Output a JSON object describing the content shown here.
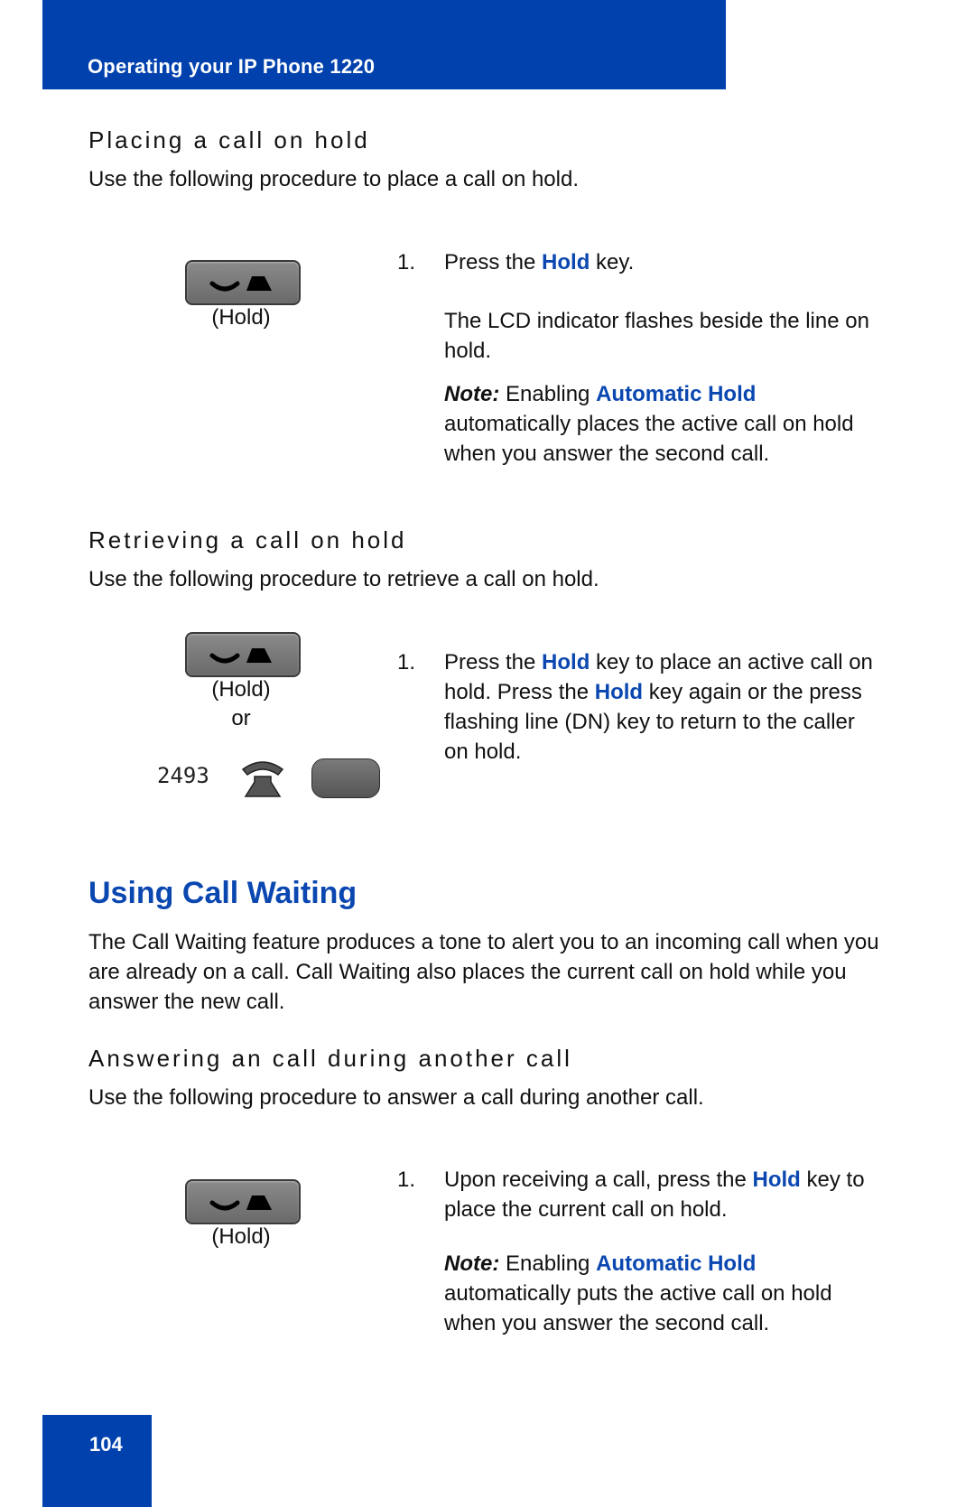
{
  "header": {
    "title": "Operating your IP Phone 1220"
  },
  "colors": {
    "brand_blue": "#0041ad",
    "link_blue": "#0a47b0"
  },
  "section_placing": {
    "heading": "Placing a call on hold",
    "intro": "Use the following procedure to place a call on hold.",
    "key_caption": "(Hold)",
    "step_number": "1.",
    "step_pre": "Press the ",
    "step_key": "Hold",
    "step_post": " key.",
    "detail": "The LCD indicator flashes beside the line on hold.",
    "note_label": "Note:",
    "note_pre": " Enabling ",
    "note_feature": "Automatic Hold",
    "note_post": " automatically places the active call on hold when you answer the second call."
  },
  "section_retrieving": {
    "heading": "Retrieving a call on hold",
    "intro": "Use the following procedure to retrieve a call on hold.",
    "key_caption": "(Hold)",
    "or_label": "or",
    "dn_number": "2493",
    "step_number": "1.",
    "step_a": "Press the ",
    "step_key1": "Hold",
    "step_b": " key to place an active call on hold. Press the ",
    "step_key2": "Hold",
    "step_c": " key again or the press flashing line (DN) key to return to the caller on hold."
  },
  "section_call_waiting": {
    "title": "Using Call Waiting",
    "description": "The Call Waiting feature produces a tone to alert you to an incoming call when you are already on a call. Call Waiting also places the current call on hold while you answer the new call."
  },
  "section_answering": {
    "heading": "Answering an call during another call",
    "intro": "Use the following procedure to answer a call during another call.",
    "key_caption": "(Hold)",
    "step_number": "1.",
    "step_pre": "Upon receiving a call, press the ",
    "step_key": "Hold",
    "step_post": " key to place the current call on hold.",
    "note_label": "Note:",
    "note_pre": " Enabling ",
    "note_feature": "Automatic Hold",
    "note_post": " automatically puts the active call on hold when you answer the second call."
  },
  "footer": {
    "page_number": "104"
  }
}
